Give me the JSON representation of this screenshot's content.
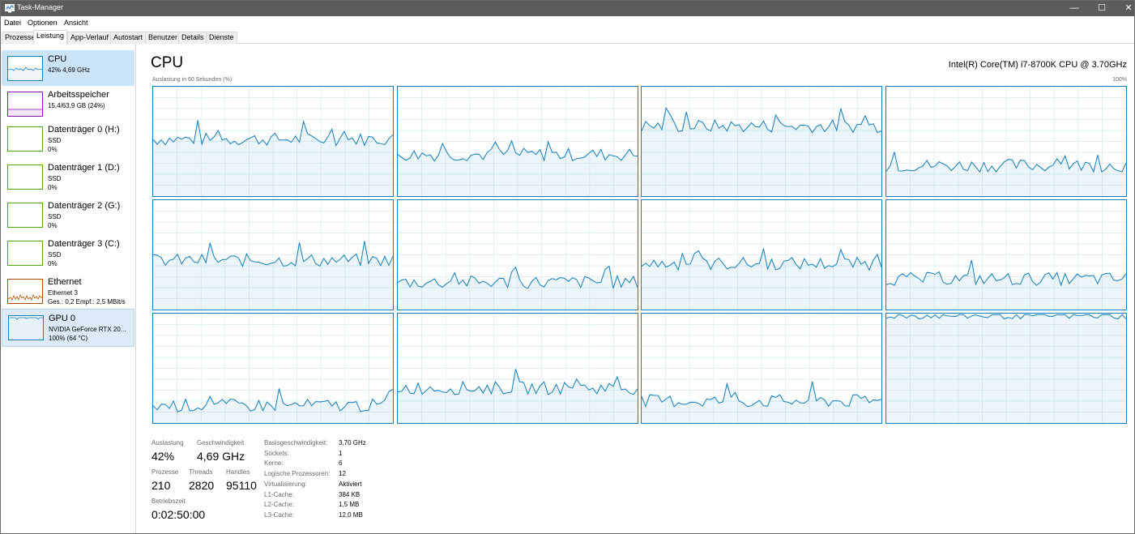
{
  "window": {
    "title": "Task-Manager",
    "controls": {
      "minimize": "—",
      "maximize": "☐",
      "close": "✕"
    }
  },
  "menu": [
    "Datei",
    "Optionen",
    "Ansicht"
  ],
  "tabs": [
    "Prozesse",
    "Leistung",
    "App-Verlauf",
    "Autostart",
    "Benutzer",
    "Details",
    "Dienste"
  ],
  "active_tab": "Leistung",
  "sidebar": {
    "items": [
      {
        "name": "CPU",
        "line1": "42% 4,69 GHz",
        "line2": "",
        "color": "#117dbb"
      },
      {
        "name": "Arbeitsspeicher",
        "line1": "15,4/63,9 GB (24%)",
        "line2": "",
        "color": "#8b12ae"
      },
      {
        "name": "Datenträger 0 (H:)",
        "line1": "SSD",
        "line2": "0%",
        "color": "#4da60c"
      },
      {
        "name": "Datenträger 1 (D:)",
        "line1": "SSD",
        "line2": "0%",
        "color": "#4da60c"
      },
      {
        "name": "Datenträger 2 (G:)",
        "line1": "SSD",
        "line2": "0%",
        "color": "#4da60c"
      },
      {
        "name": "Datenträger 3 (C:)",
        "line1": "SSD",
        "line2": "0%",
        "color": "#4da60c"
      },
      {
        "name": "Ethernet",
        "line1": "Ethernet 3",
        "line2": "Ges.: 0,2  Empf.: 2,5 MBit/s",
        "color": "#a74f01"
      },
      {
        "name": "GPU 0",
        "line1": "NVIDIA GeForce RTX 20...",
        "line2": "100%  (64 °C)",
        "color": "#117dbb"
      }
    ]
  },
  "main": {
    "title": "CPU",
    "model": "Intel(R) Core(TM) i7-8700K CPU @ 3.70GHz",
    "graph_caption": "Auslastung in 60 Sekunden (%)",
    "graph_max": "100%",
    "logical_processor_levels_pct": [
      52,
      38,
      64,
      28,
      45,
      25,
      42,
      28,
      16,
      32,
      20,
      98
    ]
  },
  "stats": {
    "auslastung_label": "Auslastung",
    "auslastung": "42%",
    "geschwindigkeit_label": "Geschwindigkeit",
    "geschwindigkeit": "4,69 GHz",
    "prozesse_label": "Prozesse",
    "prozesse": "210",
    "threads_label": "Threads",
    "threads": "2820",
    "handles_label": "Handles",
    "handles": "95110",
    "betriebszeit_label": "Betriebszeit",
    "betriebszeit": "0:02:50:00",
    "details": [
      {
        "key": "Basisgeschwindigkeit:",
        "value": "3,70 GHz"
      },
      {
        "key": "Sockets:",
        "value": "1"
      },
      {
        "key": "Kerne:",
        "value": "6"
      },
      {
        "key": "Logische Prozessoren:",
        "value": "12"
      },
      {
        "key": "Virtualisierung:",
        "value": "Aktiviert"
      },
      {
        "key": "L1-Cache:",
        "value": "384 KB"
      },
      {
        "key": "L2-Cache:",
        "value": "1,5 MB"
      },
      {
        "key": "L3-Cache:",
        "value": "12,0 MB"
      }
    ]
  }
}
